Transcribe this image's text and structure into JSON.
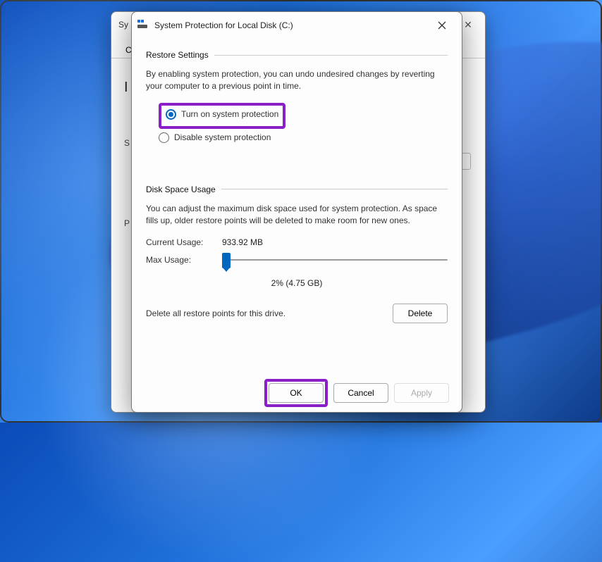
{
  "parent_window": {
    "title_prefix": "Sy",
    "tab_prefix": "Co",
    "body_letters": {
      "a": "I",
      "b": "S",
      "c": "P"
    }
  },
  "dialog": {
    "title": "System Protection for Local Disk (C:)",
    "restore": {
      "header": "Restore Settings",
      "description": "By enabling system protection, you can undo undesired changes by reverting your computer to a previous point in time.",
      "radio_on": "Turn on system protection",
      "radio_off": "Disable system protection"
    },
    "disk": {
      "header": "Disk Space Usage",
      "description": "You can adjust the maximum disk space used for system protection. As space fills up, older restore points will be deleted to make room for new ones.",
      "current_label": "Current Usage:",
      "current_value": "933.92 MB",
      "max_label": "Max Usage:",
      "slider_percent": 2,
      "slider_caption": "2% (4.75 GB)",
      "delete_text": "Delete all restore points for this drive.",
      "delete_button": "Delete"
    },
    "footer": {
      "ok": "OK",
      "cancel": "Cancel",
      "apply": "Apply"
    }
  }
}
